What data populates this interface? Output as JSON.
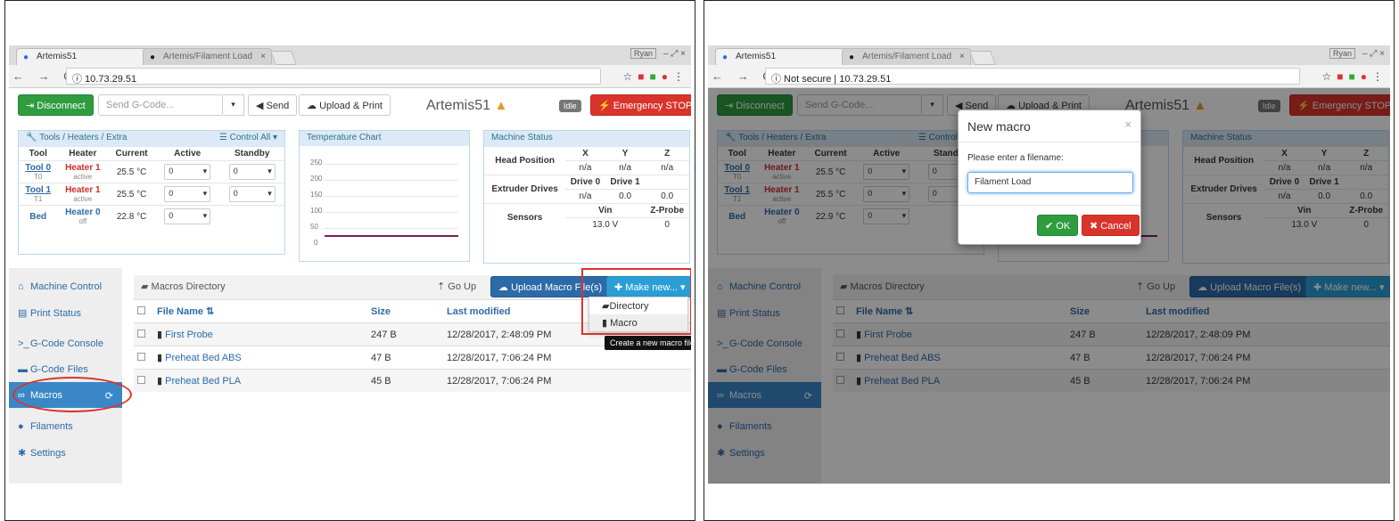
{
  "browser": {
    "tab1": "Artemis51",
    "tab2": "Artemis/Filament Load",
    "user": "Ryan",
    "nav": "← → C",
    "url_left": "ⓘ 10.73.29.51",
    "url_right": "ⓘ Not secure | 10.73.29.51"
  },
  "toolbar": {
    "disconnect": "Disconnect",
    "gcode_placeholder": "Send G-Code...",
    "send": "Send",
    "upload_print": "Upload & Print",
    "title": "Artemis51",
    "status": "Idle",
    "emergency": "Emergency STOP"
  },
  "tools_panel": {
    "header": "Tools / Heaters / Extra",
    "control_all": "Control All",
    "columns": [
      "Tool",
      "Heater",
      "Current",
      "Active",
      "Standby"
    ],
    "rows": [
      {
        "tool": "Tool 0",
        "tool_sub": "T0",
        "heater": "Heater 1",
        "heater_sub": "active",
        "current": "25.5 °C",
        "active": "0",
        "standby": "0"
      },
      {
        "tool": "Tool 1",
        "tool_sub": "T1",
        "heater": "Heater 1",
        "heater_sub": "active",
        "current": "25.5 °C",
        "active": "0",
        "standby": "0"
      },
      {
        "tool": "Bed",
        "tool_sub": "",
        "heater": "Heater 0",
        "heater_sub": "off",
        "current": "22.8 °C",
        "active": "0",
        "standby": ""
      }
    ],
    "bed_current_right": "22.9 °C"
  },
  "temp_chart": {
    "header": "Temperature Chart",
    "ticks": [
      "250",
      "200",
      "150",
      "100",
      "50",
      "0"
    ]
  },
  "machine_status": {
    "header": "Machine Status",
    "head_position": "Head Position",
    "axes": [
      "X",
      "Y",
      "Z"
    ],
    "pos_values": [
      "n/a",
      "n/a",
      "n/a"
    ],
    "extruder_drives": "Extruder Drives",
    "drives": [
      "Drive 0",
      "Drive 1"
    ],
    "drive_values": [
      "n/a",
      "0.0",
      "0.0"
    ],
    "sensors": "Sensors",
    "sensor_cols": [
      "Vin",
      "Z-Probe"
    ],
    "sensor_values": [
      "13.0 V",
      "0"
    ]
  },
  "sidebar": {
    "items": [
      "Machine Control",
      "Print Status",
      "G-Code Console",
      "G-Code Files",
      "Macros",
      "Filaments",
      "Settings"
    ]
  },
  "macros": {
    "dir_label": "Macros Directory",
    "go_up": "Go Up",
    "upload": "Upload Macro File(s)",
    "make_new": "Make new...",
    "columns": [
      "File Name",
      "Size",
      "Last modified"
    ],
    "files": [
      {
        "name": "First Probe",
        "size": "247 B",
        "modified": "12/28/2017, 2:48:09 PM"
      },
      {
        "name": "Preheat Bed ABS",
        "size": "47 B",
        "modified": "12/28/2017, 7:06:24 PM"
      },
      {
        "name": "Preheat Bed PLA",
        "size": "45 B",
        "modified": "12/28/2017, 7:06:24 PM"
      }
    ],
    "dropdown": [
      "Directory",
      "Macro"
    ],
    "tooltip": "Create a new macro file"
  },
  "modal": {
    "title": "New macro",
    "prompt": "Please enter a filename:",
    "value": "Filament Load",
    "ok": "OK",
    "cancel": "Cancel"
  },
  "colors": {
    "annotation": "#d9342b",
    "accent": "#2c6aa8"
  }
}
